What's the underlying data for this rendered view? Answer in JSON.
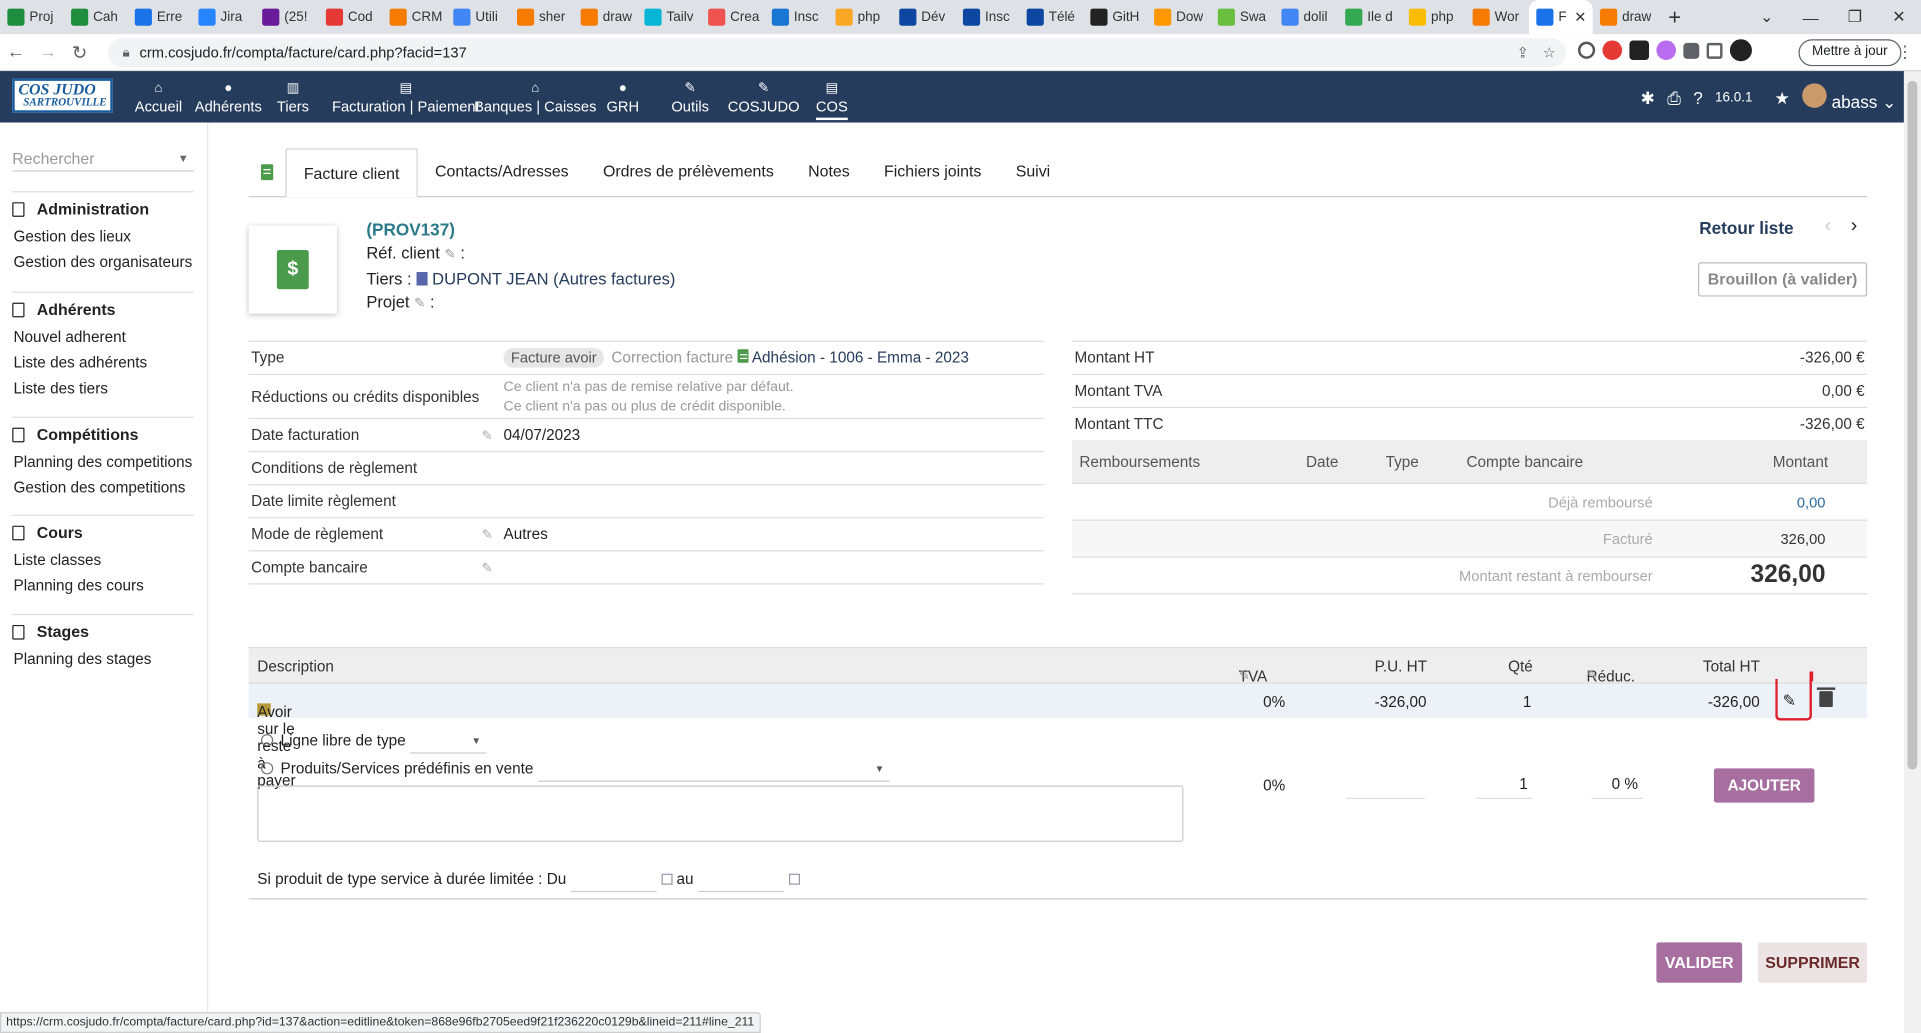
{
  "browser": {
    "tabs": [
      {
        "label": "Proj",
        "color": "#1e8e3e"
      },
      {
        "label": "Cah",
        "color": "#1e8e3e"
      },
      {
        "label": "Erre",
        "color": "#1a73e8"
      },
      {
        "label": "Jira",
        "color": "#2684ff"
      },
      {
        "label": "(25!",
        "color": "#6a1b9a"
      },
      {
        "label": "Cod",
        "color": "#e53935"
      },
      {
        "label": "CRM",
        "color": "#f57c00"
      },
      {
        "label": "Utili",
        "color": "#4285f4"
      },
      {
        "label": "sher",
        "color": "#f57c00"
      },
      {
        "label": "draw",
        "color": "#f57c00"
      },
      {
        "label": "Tailv",
        "color": "#06b6d4"
      },
      {
        "label": "Crea",
        "color": "#ef5350"
      },
      {
        "label": "Insc",
        "color": "#1976d2"
      },
      {
        "label": "php",
        "color": "#f9a825"
      },
      {
        "label": "Dév",
        "color": "#0d47a1"
      },
      {
        "label": "Insc",
        "color": "#0d47a1"
      },
      {
        "label": "Télé",
        "color": "#0d47a1"
      },
      {
        "label": "GitH",
        "color": "#222222"
      },
      {
        "label": "Dow",
        "color": "#ff9800"
      },
      {
        "label": "Swa",
        "color": "#6abf40"
      },
      {
        "label": "dolil",
        "color": "#4285f4"
      },
      {
        "label": "Ile d",
        "color": "#34a853"
      },
      {
        "label": "php",
        "color": "#fbbc04"
      },
      {
        "label": "Wor",
        "color": "#f57c00"
      },
      {
        "label": "F",
        "color": "#1a73e8",
        "active": true
      },
      {
        "label": "draw",
        "color": "#f57c00"
      }
    ],
    "new_tab": "+",
    "url": "crm.cosjudo.fr/compta/facture/card.php?facid=137",
    "update_button": "Mettre à jour",
    "status_url": "https://crm.cosjudo.fr/compta/facture/card.php?id=137&action=editline&token=868e96fb2705eed9f21f236220c0129b&lineid=211#line_211"
  },
  "app": {
    "logo_line1": "COS JUDO",
    "logo_line2": "SARTROUVILLE",
    "menu": [
      {
        "label": "Accueil",
        "icon": "home-icon",
        "glyph": "⌂"
      },
      {
        "label": "Adhérents",
        "icon": "user-icon",
        "glyph": "●"
      },
      {
        "label": "Tiers",
        "icon": "building-icon",
        "glyph": "▥"
      },
      {
        "label": "Facturation | Paiement",
        "icon": "money-icon",
        "glyph": "▤"
      },
      {
        "label": "Banques | Caisses",
        "icon": "bank-icon",
        "glyph": "⌂"
      },
      {
        "label": "GRH",
        "icon": "person-icon",
        "glyph": "●"
      },
      {
        "label": "Outils",
        "icon": "wrench-icon",
        "glyph": "✎"
      },
      {
        "label": "COSJUDO",
        "icon": "edit-icon",
        "glyph": "✎"
      },
      {
        "label": "COS",
        "icon": "doc-icon",
        "glyph": "▤"
      }
    ],
    "version": "16.0.1",
    "user": "abass"
  },
  "sidebar": {
    "search_placeholder": "Rechercher",
    "sections": [
      {
        "title": "Administration",
        "items": [
          "Gestion des lieux",
          "Gestion des organisateurs"
        ]
      },
      {
        "title": "Adhérents",
        "items": [
          "Nouvel adherent",
          "Liste des adhérents",
          "Liste des tiers"
        ]
      },
      {
        "title": "Compétitions",
        "items": [
          "Planning des competitions",
          "Gestion des competitions"
        ]
      },
      {
        "title": "Cours",
        "items": [
          "Liste classes",
          "Planning des cours"
        ]
      },
      {
        "title": "Stages",
        "items": [
          "Planning des stages"
        ]
      }
    ]
  },
  "tabs": [
    "Facture client",
    "Contacts/Adresses",
    "Ordres de prélèvements",
    "Notes",
    "Fichiers joints",
    "Suivi"
  ],
  "invoice": {
    "ref": "(PROV137)",
    "ref_client_label": "Réf. client",
    "tiers_label": "Tiers :",
    "tiers_value": "DUPONT JEAN (Autres factures)",
    "projet_label": "Projet",
    "retour": "Retour liste",
    "status": "Brouillon (à valider)"
  },
  "fields": {
    "type_label": "Type",
    "type_badge": "Facture avoir",
    "type_correction": "Correction facture",
    "type_link": "Adhésion - 1006 - Emma - 2023",
    "reductions_label": "Réductions ou crédits disponibles",
    "reductions_line1": "Ce client n'a pas de remise relative par défaut.",
    "reductions_line2": "Ce client n'a pas ou plus de crédit disponible.",
    "date_label": "Date facturation",
    "date_value": "04/07/2023",
    "conditions_label": "Conditions de règlement",
    "limite_label": "Date limite règlement",
    "mode_label": "Mode de règlement",
    "mode_value": "Autres",
    "compte_label": "Compte bancaire"
  },
  "amounts": {
    "ht_label": "Montant HT",
    "ht_value": "-326,00 €",
    "tva_label": "Montant TVA",
    "tva_value": "0,00 €",
    "ttc_label": "Montant TTC",
    "ttc_value": "-326,00 €",
    "remb_headers": [
      "Remboursements",
      "Date",
      "Type",
      "Compte bancaire",
      "Montant"
    ],
    "deja_label": "Déjà remboursé",
    "deja_value": "0,00",
    "facture_label": "Facturé",
    "facture_value": "326,00",
    "restant_label": "Montant restant à rembourser",
    "restant_value": "326,00"
  },
  "lines": {
    "headers": {
      "desc": "Description",
      "tva": "TVA",
      "pu": "P.U. HT",
      "qte": "Qté",
      "reduc": "Réduc.",
      "total": "Total HT"
    },
    "row": {
      "desc": "Avoir sur le reste à payer",
      "tva": "0%",
      "pu": "-326,00",
      "qte": "1",
      "total": "-326,00"
    }
  },
  "add_line": {
    "free_line_label": "Ligne libre de type",
    "predef_label": "Produits/Services prédéfinis en vente",
    "tva": "0%",
    "qty": "1",
    "reduc": "0 %",
    "add_button": "AJOUTER",
    "duration_label": "Si produit de type service à durée limitée : Du",
    "au_label": "au"
  },
  "actions": {
    "valider": "VALIDER",
    "supprimer": "SUPPRIMER"
  }
}
